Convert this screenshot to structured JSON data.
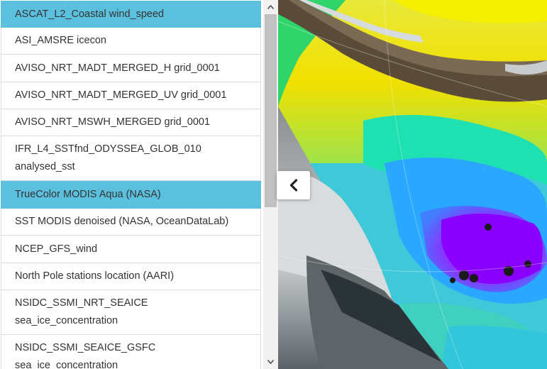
{
  "layers": [
    {
      "label": "ASCAT_L2_Coastal wind_speed",
      "active": true
    },
    {
      "label": "ASI_AMSRE icecon",
      "active": false
    },
    {
      "label": "AVISO_NRT_MADT_MERGED_H grid_0001",
      "active": false
    },
    {
      "label": "AVISO_NRT_MADT_MERGED_UV grid_0001",
      "active": false
    },
    {
      "label": "AVISO_NRT_MSWH_MERGED grid_0001",
      "active": false
    },
    {
      "label": "IFR_L4_SSTfnd_ODYSSEA_GLOB_010\nanalysed_sst",
      "active": false
    },
    {
      "label": "TrueColor MODIS Aqua (NASA)",
      "active": true
    },
    {
      "label": "SST MODIS denoised (NASA, OceanDataLab)",
      "active": false
    },
    {
      "label": "NCEP_GFS_wind",
      "active": false
    },
    {
      "label": "North Pole stations location (AARI)",
      "active": false
    },
    {
      "label": "NSIDC_SSMI_NRT_SEAICE\nsea_ice_concentration",
      "active": false
    },
    {
      "label": "NSIDC_SSMI_SEAICE_GSFC\nsea_ice_concentration",
      "active": false
    }
  ],
  "colors": {
    "active_row": "#5bc0de",
    "row_border": "#dddddd",
    "text": "#333333"
  },
  "icons": {
    "scroll_up": "triangle-up-icon",
    "scroll_down": "triangle-down-icon",
    "collapse": "chevron-left-icon"
  }
}
